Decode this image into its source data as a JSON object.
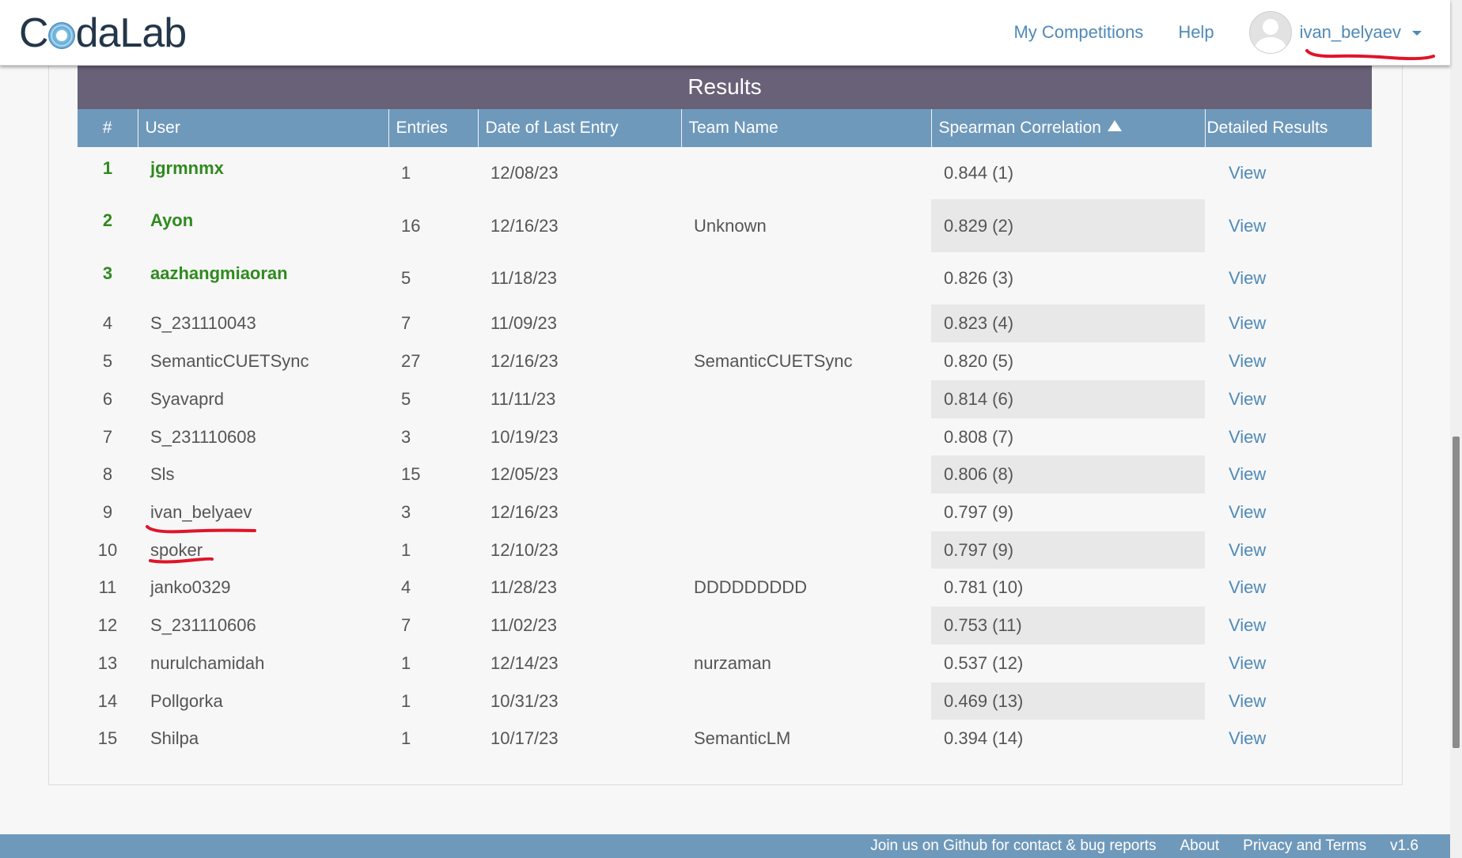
{
  "header": {
    "logo_text_prefix": "C",
    "logo_text_suffix": "daLab",
    "nav": [
      "My Competitions",
      "Help"
    ],
    "username": "ivan_belyaev"
  },
  "results": {
    "title": "Results",
    "columns": [
      "#",
      "User",
      "Entries",
      "Date of Last Entry",
      "Team Name",
      "Spearman Correlation",
      "Detailed Results"
    ],
    "rows": [
      {
        "rank": "1",
        "user": "jgrmnmx",
        "entries": "1",
        "date": "12/08/23",
        "team": "",
        "score": "0.844 (1)",
        "detail": "View"
      },
      {
        "rank": "2",
        "user": "Ayon",
        "entries": "16",
        "date": "12/16/23",
        "team": "Unknown",
        "score": "0.829 (2)",
        "detail": "View"
      },
      {
        "rank": "3",
        "user": "aazhangmiaoran",
        "entries": "5",
        "date": "11/18/23",
        "team": "",
        "score": "0.826 (3)",
        "detail": "View"
      },
      {
        "rank": "4",
        "user": "S_231110043",
        "entries": "7",
        "date": "11/09/23",
        "team": "",
        "score": "0.823 (4)",
        "detail": "View"
      },
      {
        "rank": "5",
        "user": "SemanticCUETSync",
        "entries": "27",
        "date": "12/16/23",
        "team": "SemanticCUETSync",
        "score": "0.820 (5)",
        "detail": "View"
      },
      {
        "rank": "6",
        "user": "Syavaprd",
        "entries": "5",
        "date": "11/11/23",
        "team": "",
        "score": "0.814 (6)",
        "detail": "View"
      },
      {
        "rank": "7",
        "user": "S_231110608",
        "entries": "3",
        "date": "10/19/23",
        "team": "",
        "score": "0.808 (7)",
        "detail": "View"
      },
      {
        "rank": "8",
        "user": "Sls",
        "entries": "15",
        "date": "12/05/23",
        "team": "",
        "score": "0.806 (8)",
        "detail": "View"
      },
      {
        "rank": "9",
        "user": "ivan_belyaev",
        "entries": "3",
        "date": "12/16/23",
        "team": "",
        "score": "0.797 (9)",
        "detail": "View"
      },
      {
        "rank": "10",
        "user": "spoker",
        "entries": "1",
        "date": "12/10/23",
        "team": "",
        "score": "0.797 (9)",
        "detail": "View"
      },
      {
        "rank": "11",
        "user": "janko0329",
        "entries": "4",
        "date": "11/28/23",
        "team": "DDDDDDDDD",
        "score": "0.781 (10)",
        "detail": "View"
      },
      {
        "rank": "12",
        "user": "S_231110606",
        "entries": "7",
        "date": "11/02/23",
        "team": "",
        "score": "0.753 (11)",
        "detail": "View"
      },
      {
        "rank": "13",
        "user": "nurulchamidah",
        "entries": "1",
        "date": "12/14/23",
        "team": "nurzaman",
        "score": "0.537 (12)",
        "detail": "View"
      },
      {
        "rank": "14",
        "user": "Pollgorka",
        "entries": "1",
        "date": "10/31/23",
        "team": "",
        "score": "0.469 (13)",
        "detail": "View"
      },
      {
        "rank": "15",
        "user": "Shilpa",
        "entries": "1",
        "date": "10/17/23",
        "team": "SemanticLM",
        "score": "0.394 (14)",
        "detail": "View"
      }
    ]
  },
  "footer": {
    "links": [
      "Join us on Github for contact & bug reports",
      "About",
      "Privacy and Terms",
      "v1.6"
    ]
  },
  "colors": {
    "header_bar": "#686177",
    "table_header": "#6f99bb",
    "link": "#4f8ab8",
    "top_rank": "#2f8a1e",
    "annotation": "#e0142a"
  }
}
